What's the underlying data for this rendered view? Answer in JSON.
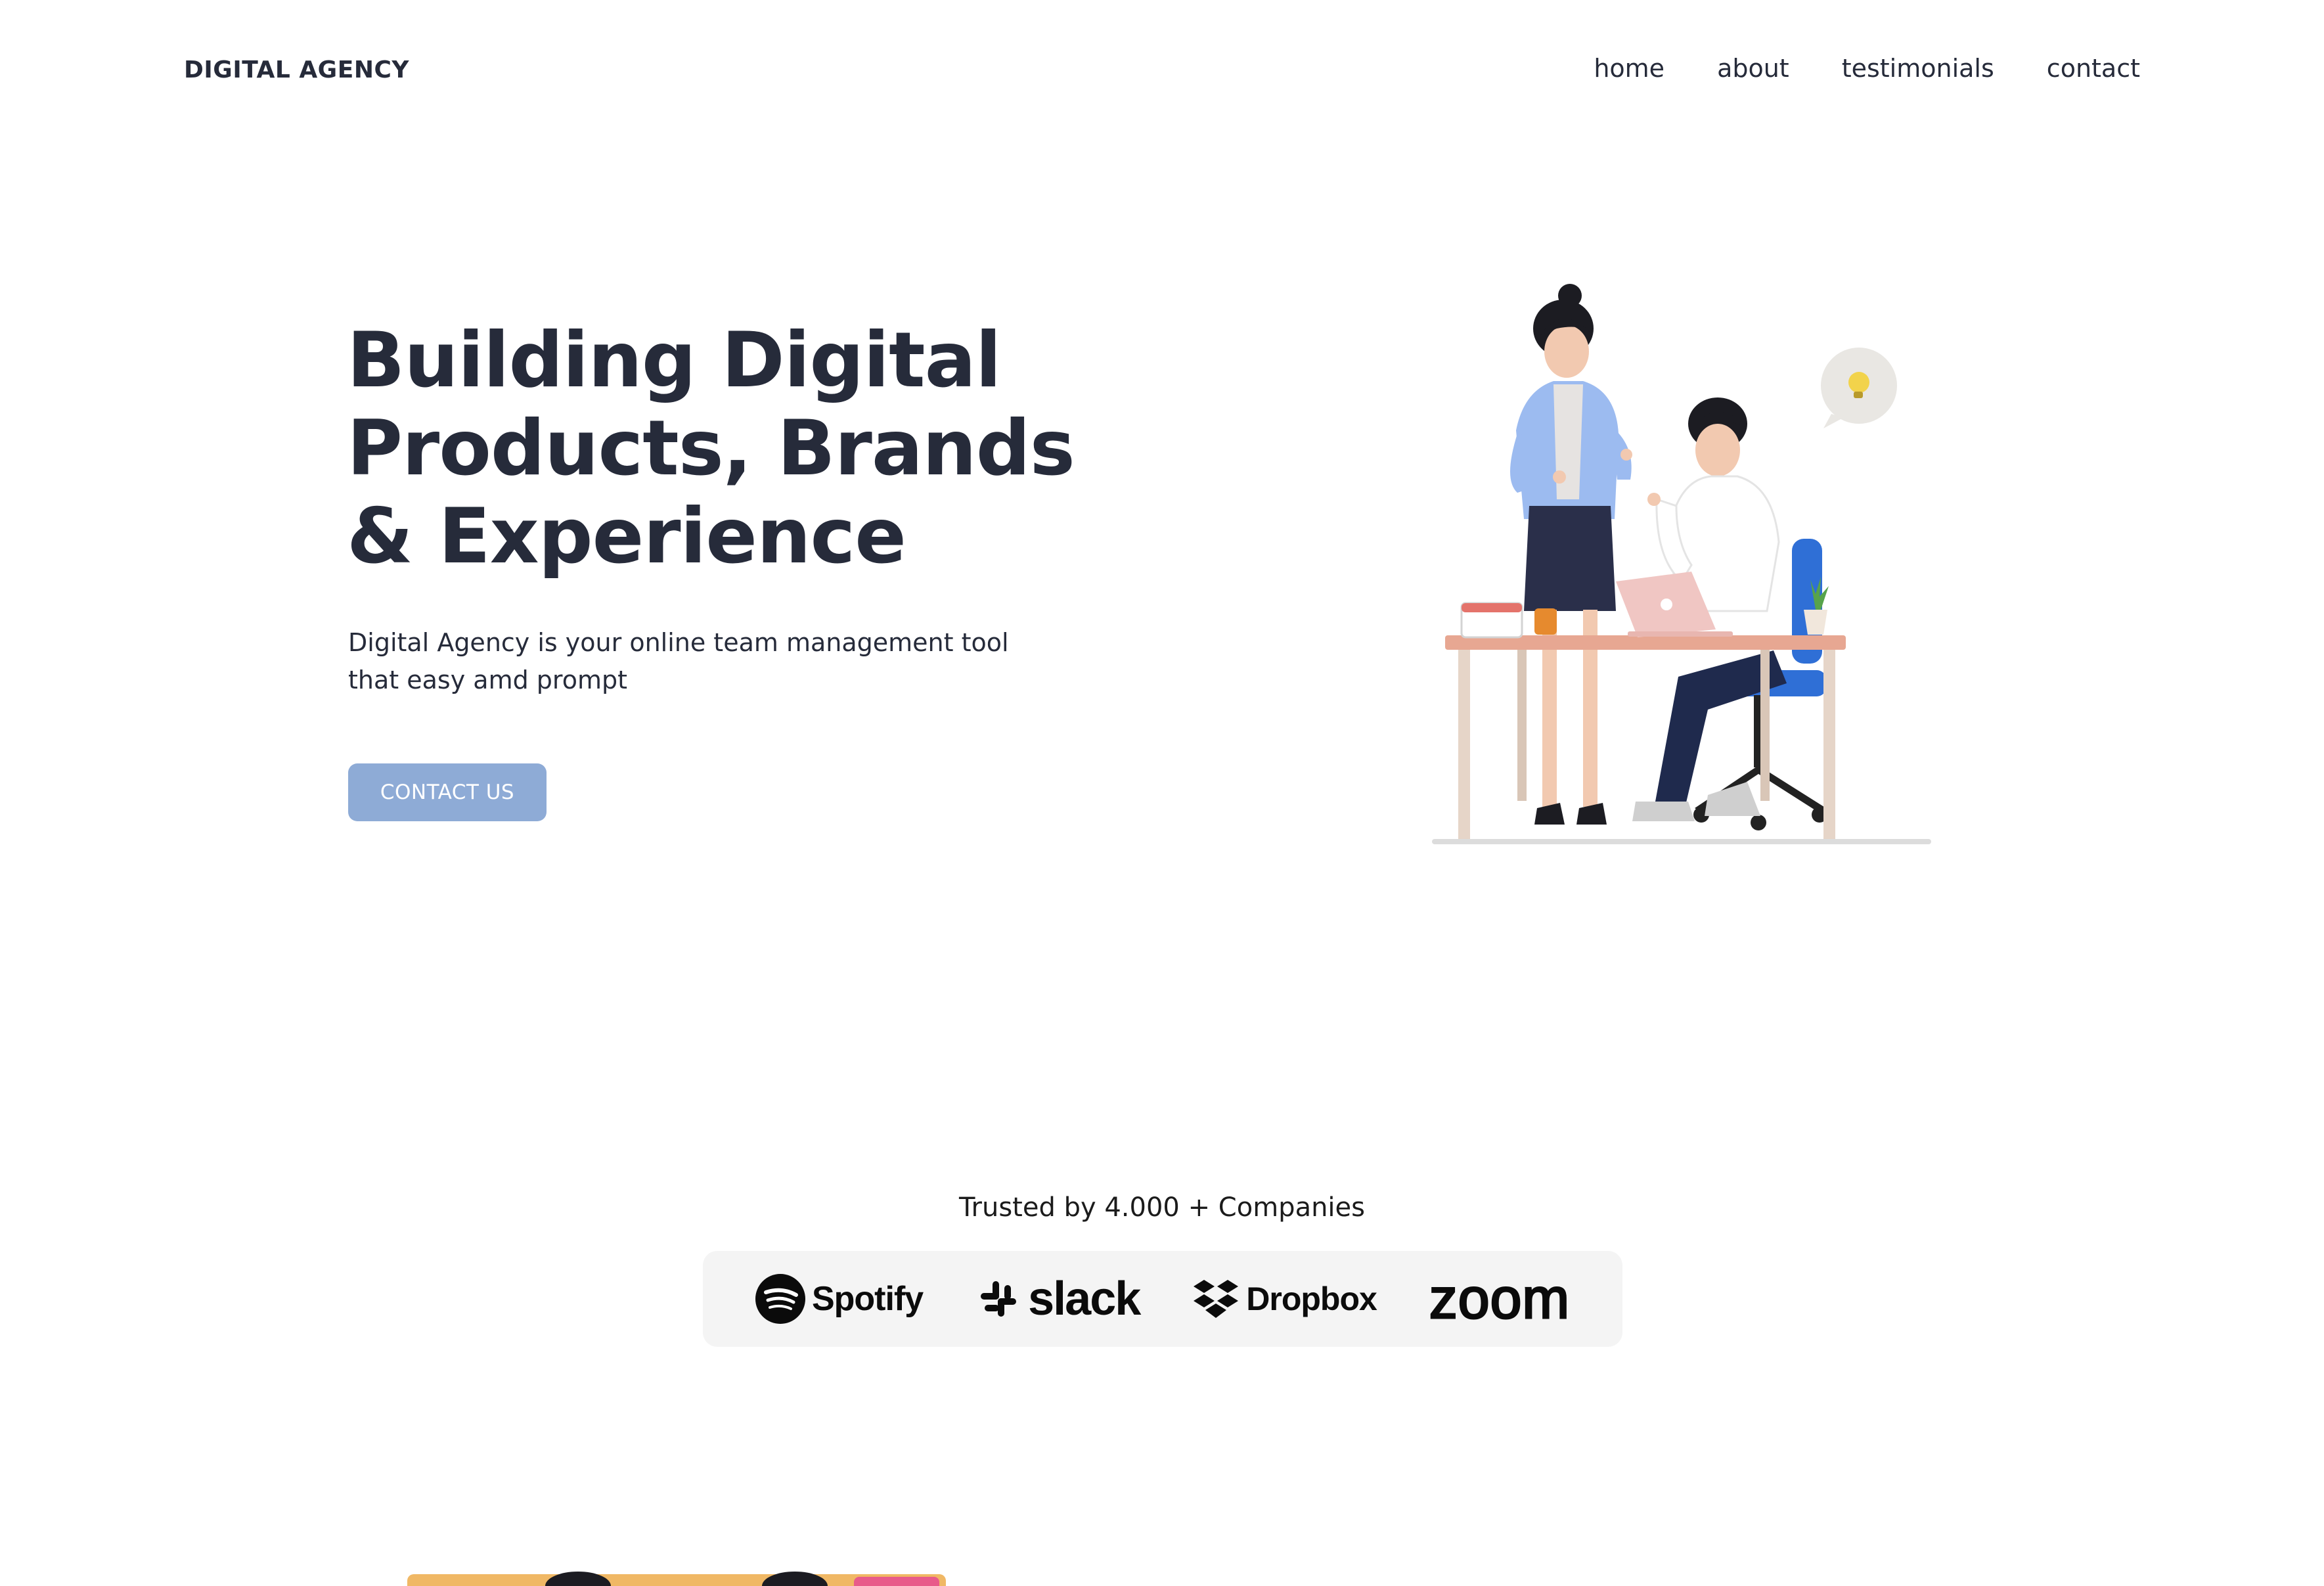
{
  "header": {
    "brand": "DIGITAL AGENCY",
    "nav": [
      "home",
      "about",
      "testimonials",
      "contact"
    ]
  },
  "hero": {
    "title_lines": [
      "Building Digital",
      "Products, Brands",
      "& Experience"
    ],
    "subtitle_lines": [
      "Digital Agency is your online team management tool",
      "that easy amd prompt"
    ],
    "cta_label": "CONTACT US"
  },
  "trusted": {
    "text": "Trusted by 4.000 + Companies",
    "logos": [
      "Spotify",
      "slack",
      "Dropbox",
      "zoom"
    ]
  },
  "colors": {
    "text": "#262b3a",
    "cta": "#8eabd6",
    "logo_strip_bg": "#f4f4f4"
  }
}
